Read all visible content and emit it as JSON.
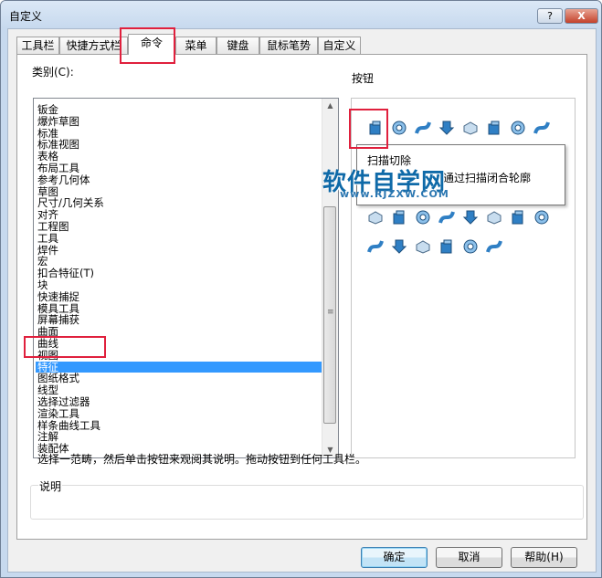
{
  "window": {
    "title": "自定义",
    "help_label": "?",
    "close_label": "X"
  },
  "tabs": [
    "工具栏",
    "快捷方式栏",
    "命令",
    "菜单",
    "键盘",
    "鼠标笔势",
    "自定义"
  ],
  "category": {
    "label": "类别(C):",
    "items": [
      "钣金",
      "爆炸草图",
      "标准",
      "标准视图",
      "表格",
      "布局工具",
      "参考几何体",
      "草图",
      "尺寸/几何关系",
      "对齐",
      "工程图",
      "工具",
      "焊件",
      "宏",
      "扣合特征(T)",
      "块",
      "快速捕捉",
      "模具工具",
      "屏幕捕获",
      "曲面",
      "曲线",
      "视图",
      "特征",
      "图纸格式",
      "线型",
      "选择过滤器",
      "渲染工具",
      "样条曲线工具",
      "注解",
      "装配体"
    ],
    "selected": "特征"
  },
  "buttons_panel": {
    "label": "按钮",
    "icons": [
      "extruded-boss-icon",
      "revolved-boss-icon",
      "swept-boss-icon",
      "lofted-boss-icon",
      "boundary-boss-icon",
      "extruded-cut-icon",
      "revolved-cut-icon",
      "swept-cut-icon",
      "lofted-cut-icon",
      "fillet-icon",
      "chamfer-icon",
      "rib-icon",
      "draft-icon",
      "shell-icon",
      "wrap-icon",
      "dome-icon",
      "hole-wizard-icon",
      "linear-pattern-icon",
      "circular-pattern-icon",
      "mirror-icon",
      "curve-driven-pattern-icon",
      "sketch-driven-pattern-icon",
      "table-driven-pattern-icon",
      "fill-pattern-icon",
      "combine-icon",
      "intersect-icon",
      "split-icon",
      "move-copy-icon",
      "delete-body-icon",
      "cosmetic-thread-icon",
      "freeform-icon",
      "deform-icon",
      "indent-icon",
      "flex-icon",
      "instant3d-icon",
      "feature-works-icon",
      "fastener-icon",
      "library-feature-icon"
    ]
  },
  "tooltip": {
    "title": "扫描切除",
    "description": "通过扫描闭合轮廓"
  },
  "watermark": {
    "main": "软件自学网",
    "sub": "www.RJZXW.COM"
  },
  "hint_text": "选择一范畴，然后单击按钮来观阅其说明。拖动按钮到任何工具栏。",
  "description_group": {
    "label": "说明"
  },
  "dialog_buttons": {
    "ok": "确定",
    "cancel": "取消",
    "help": "帮助(H)"
  },
  "colors": {
    "selection": "#3399ff",
    "highlight": "#e0203d",
    "icon_blue": "#2f7fc4"
  }
}
